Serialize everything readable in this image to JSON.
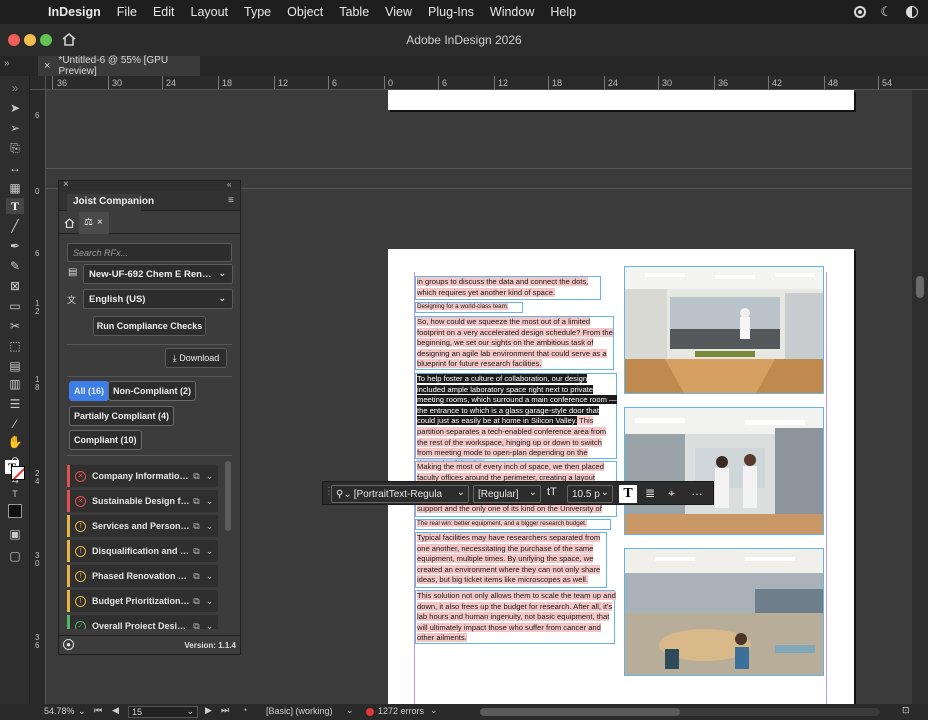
{
  "menubar": {
    "app_name": "InDesign",
    "items": [
      "File",
      "Edit",
      "Layout",
      "Type",
      "Object",
      "Table",
      "View",
      "Plug-Ins",
      "Window",
      "Help"
    ]
  },
  "window": {
    "title": "Adobe InDesign 2026"
  },
  "doc_tab": {
    "label": "*Untitled-6 @ 55% [GPU Preview]"
  },
  "ruler": {
    "ticks": [
      "36",
      "30",
      "24",
      "18",
      "12",
      "6",
      "0",
      "6",
      "12",
      "18",
      "24",
      "30",
      "36",
      "42",
      "48",
      "54"
    ],
    "vticks": [
      "6",
      "0",
      "6",
      "1\n2",
      "1\n8",
      "2\n4",
      "3\n0",
      "3\n6"
    ]
  },
  "panel": {
    "title": "Joist Companion",
    "search_placeholder": "Search RFx...",
    "rfx_select": "New-UF-692 Chem E Renova...",
    "language_select": "English (US)",
    "run_button": "Run Compliance Checks",
    "download_button": "Download",
    "filters": [
      "All (16)",
      "Non-Compliant (2)",
      "Partially Compliant (4)",
      "Compliant (10)"
    ],
    "items": [
      {
        "label": "Company Information...",
        "status": "non-compliant"
      },
      {
        "label": "Sustainable Design for...",
        "status": "non-compliant"
      },
      {
        "label": "Services and Personne...",
        "status": "partial"
      },
      {
        "label": "Disqualification and In...",
        "status": "partial"
      },
      {
        "label": "Phased Renovation Ap...",
        "status": "partial"
      },
      {
        "label": "Budget Prioritization a...",
        "status": "partial"
      },
      {
        "label": "Overall Project Design...",
        "status": "compliant"
      }
    ],
    "version": "Version: 1.1.4"
  },
  "document": {
    "p1": "in groups to discuss the data and connect the dots, which requires yet another kind of space.",
    "h1": "Designing for a world-class team.",
    "p2": "So, how could we squeeze the most out of a limited footprint on a very accelerated design schedule? From the beginning, we set our sights on the ambitious task of designing an agile lab environment that could serve as a blueprint for future research facilities.",
    "p3_selected": "To help foster a culture of collaboration, our design included ample laboratory space right next to private meeting rooms, which surround a main conference room — the entrance to which is a glass garage-style door that could just as easily be at home in Silicon Valley.",
    "p3_rest": " This partition separates a tech-enabled conference area from the rest of the workspace, hinging up or down to switch from meeting mode to open-plan depending on the demands of the day.",
    "p4a": "Making the most of every inch of space, we then placed",
    "p4b": "faculty offices around the perimeter, creating a layout",
    "p4c": "support and the only one of its kind on the University of",
    "h2": "The real win: better equipment, and a bigger research budget.",
    "p5": "Typical facilities may have researchers separated from one another, necessitating the purchase of the same equipment, multiple times. By unifying the space, we created an environment where they can not only share ideas, but big ticket items like microscopes as well.",
    "p6": "This solution not only allows them to scale the team up and down, it also frees up the budget for research. After all, it's lab hours and human ingenuity, not basic equipment, that will ultimately impact those who suffer from cancer and other ailments."
  },
  "text_toolbar": {
    "font": "[PortraitText-Regula",
    "style": "[Regular]",
    "size": "10.5 p"
  },
  "status": {
    "zoom": "54.78%",
    "page": "15",
    "profile": "[Basic] (working)",
    "errors": "1272 errors"
  },
  "colors": {
    "accent": "#3d7ee6",
    "error": "#e05252",
    "warning": "#e6b54a",
    "ok": "#4fb86a",
    "frame": "#63b5e8"
  }
}
